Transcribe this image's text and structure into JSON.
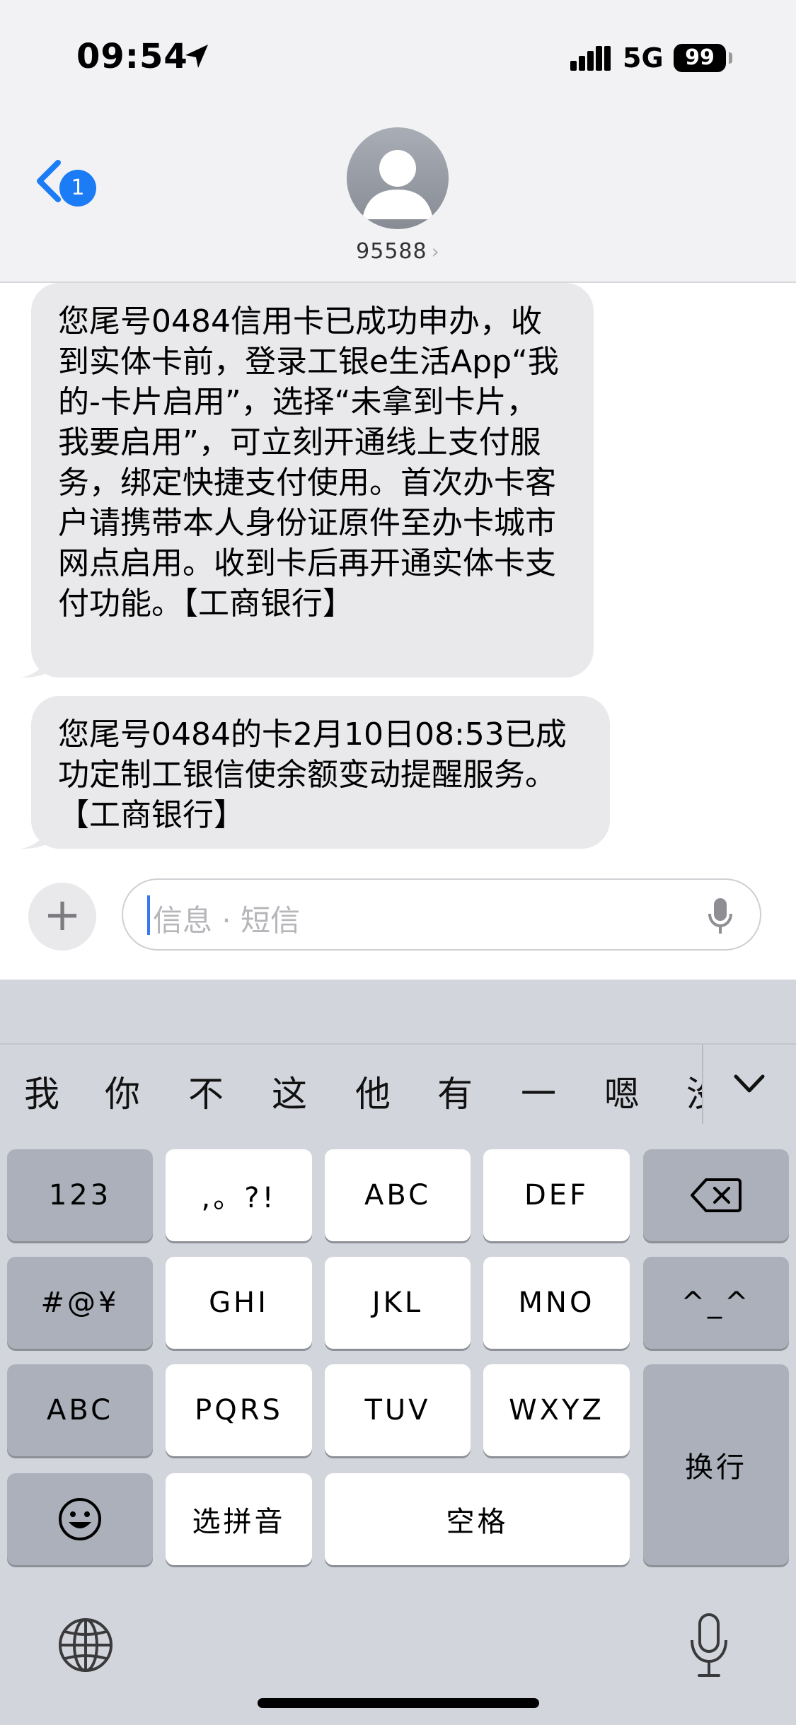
{
  "status_bar": {
    "time": "09:54",
    "network": "5G",
    "battery": "99"
  },
  "header": {
    "back_badge": "1",
    "contact": "95588",
    "contact_chevron": "›"
  },
  "messages": [
    {
      "text": "您尾号0484信用卡已成功申办，收到实体卡前，登录工银e生活App“我的-卡片启用”，选择“未拿到卡片，我要启用”，可立刻开通线上支付服务，绑定快捷支付使用。首次办卡客户请携带本人身份证原件至办卡城市网点启用。收到卡后再开通实体卡支付功能。【工商银行】"
    },
    {
      "text": "您尾号0484的卡2月10日08:53已成功定制工银信使余额变动提醒服务。【工商银行】"
    }
  ],
  "input": {
    "add_label": "+",
    "placeholder": "信息 · 短信"
  },
  "keyboard": {
    "candidates": [
      "我",
      "你",
      "不",
      "这",
      "他",
      "有",
      "一",
      "嗯",
      "没"
    ],
    "keys": {
      "num": "123",
      "punct": ",。?!",
      "abc": "ABC",
      "def": "DEF",
      "symbols": "#@¥",
      "ghi": "GHI",
      "jkl": "JKL",
      "mno": "MNO",
      "emoticon": "^_^",
      "abc_mode": "ABC",
      "pqrs": "PQRS",
      "tuv": "TUV",
      "wxyz": "WXYZ",
      "return": "换行",
      "pinyin": "选拼音",
      "space": "空格"
    }
  },
  "icons": {
    "location": "location-arrow-icon",
    "back": "chevron-left-icon",
    "avatar": "person-silhouette-icon",
    "dictation": "microphone-icon",
    "delete": "delete-backspace-icon",
    "emoji": "smiley-face-icon",
    "globe": "globe-icon",
    "collapse": "chevron-down-icon"
  },
  "colors": {
    "accent": "#1b7cf5",
    "bubble": "#e9e9eb",
    "keyboard_bg": "#d3d5dc",
    "key_dark": "#abb0bb"
  }
}
